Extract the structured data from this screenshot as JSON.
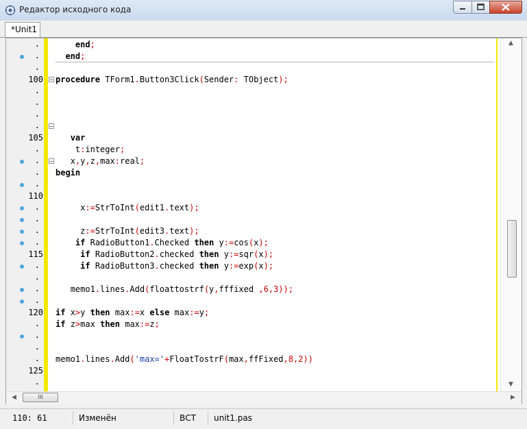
{
  "window": {
    "title": "Редактор исходного кода"
  },
  "tabs": [
    {
      "label": "*Unit1"
    }
  ],
  "gutter": [
    {
      "n": "",
      "bp": false
    },
    {
      "n": "",
      "bp": true
    },
    {
      "n": "",
      "bp": false
    },
    {
      "n": "100",
      "bp": false
    },
    {
      "n": "",
      "bp": false
    },
    {
      "n": "",
      "bp": false
    },
    {
      "n": "",
      "bp": false
    },
    {
      "n": "",
      "bp": false
    },
    {
      "n": "105",
      "bp": false
    },
    {
      "n": "",
      "bp": false
    },
    {
      "n": "",
      "bp": true
    },
    {
      "n": "",
      "bp": false
    },
    {
      "n": "",
      "bp": true
    },
    {
      "n": "110",
      "bp": false
    },
    {
      "n": "",
      "bp": true
    },
    {
      "n": "",
      "bp": true
    },
    {
      "n": "",
      "bp": true
    },
    {
      "n": "",
      "bp": true
    },
    {
      "n": "115",
      "bp": false
    },
    {
      "n": "",
      "bp": true
    },
    {
      "n": "",
      "bp": false
    },
    {
      "n": "",
      "bp": true
    },
    {
      "n": "",
      "bp": true
    },
    {
      "n": "120",
      "bp": false
    },
    {
      "n": "",
      "bp": false
    },
    {
      "n": "",
      "bp": true
    },
    {
      "n": "",
      "bp": false
    },
    {
      "n": "",
      "bp": false
    },
    {
      "n": "125",
      "bp": false
    },
    {
      "n": "",
      "bp": false
    }
  ],
  "code_lines": [
    "    end;",
    "  end;",
    "",
    "procedure TForm1.Button3Click(Sender: TObject);",
    "",
    "",
    "",
    "",
    "   var",
    "    t:integer;",
    "   x,y,z,max:real;",
    "begin",
    "",
    "",
    "     x:=StrToInt(edit1.text);",
    "",
    "     z:=StrToInt(edit3.text);",
    "    if RadioButton1.Checked then y:=cos(x);",
    "     if RadioButton2.checked then y:=sqr(x);",
    "     if RadioButton3.checked then y:=exp(x);",
    "",
    "   memo1.lines.Add(floattostrf(y,fffixed ,6,3));",
    "",
    "if x>y then max:=x else max:=y;",
    "if z>max then max:=z;",
    "",
    "",
    "memo1.lines.Add('max='+FloatTostrF(max,ffFixed,8,2))",
    "",
    ""
  ],
  "scroll": {
    "h_grip": "III"
  },
  "status": {
    "position": "110: 61",
    "state": "Изменён",
    "mode": "ВСТ",
    "file": "unit1.pas"
  }
}
